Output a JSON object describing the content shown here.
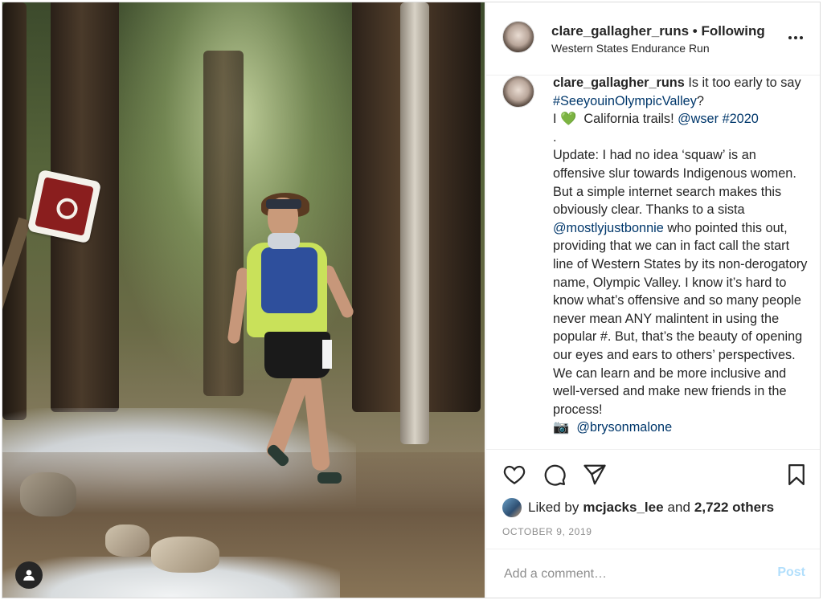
{
  "post": {
    "username": "clare_gallagher_runs",
    "separator": "•",
    "follow_status": "Following",
    "location": "Western States Endurance Run",
    "more_icon": "more-horizontal-icon"
  },
  "caption": {
    "username": "clare_gallagher_runs",
    "t1": " Is it too early to say ",
    "l1": "#SeeyouinOlympicValley",
    "t2": "?\nI ",
    "heart": "💚",
    "t3": "  California trails! ",
    "l2": "@wser",
    "t4": " ",
    "l3": "#2020",
    "t5": "\n.\nUpdate: I had no idea ‘squaw’ is an offensive slur towards Indigenous women. But a simple internet search makes this obviously clear. Thanks to a sista ",
    "l4": "@mostlyjustbonnie",
    "t6": " who pointed this out, providing that we can in fact call the start line of Western States by its non-derogatory name, Olympic Valley. I know it’s hard to know what’s offensive and so many people never mean ANY malintent in using the popular #. But, that’s the beauty of opening our eyes and ears to others’ perspectives. We can learn and be more inclusive and well-versed and make new friends in the process!\n",
    "camera": "📷",
    "t7": "  ",
    "l5": "@brysonmalone"
  },
  "actions": {
    "like_icon": "heart-icon",
    "comment_icon": "comment-icon",
    "share_icon": "share-icon",
    "save_icon": "bookmark-icon"
  },
  "likes": {
    "prefix": "Liked by",
    "user": "mcjacks_lee",
    "middle": "and",
    "count": "2,722 others"
  },
  "date": "OCTOBER 9, 2019",
  "comment_box": {
    "placeholder": "Add a comment…",
    "post_label": "Post"
  },
  "colors": {
    "link": "#00376b",
    "post_button_disabled": "#b2dffc",
    "muted": "#8e8e8e"
  }
}
